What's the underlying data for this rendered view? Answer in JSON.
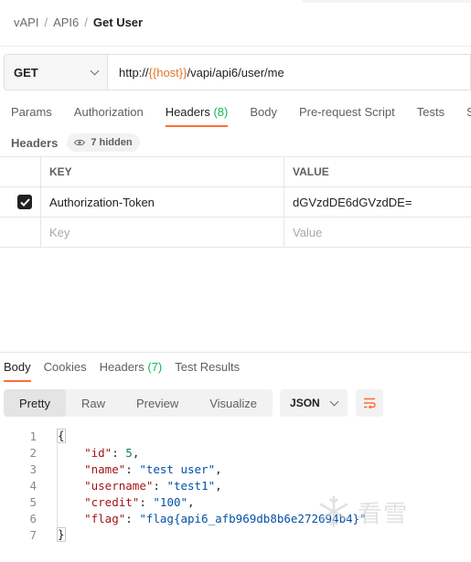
{
  "breadcrumb": {
    "items": [
      "vAPI",
      "API6"
    ],
    "separator": "/",
    "current": "Get User"
  },
  "request": {
    "method": "GET",
    "url_prefix": "http://",
    "url_variable": "{{host}}",
    "url_suffix": "/vapi/api6/user/me"
  },
  "request_tabs": [
    {
      "label": "Params",
      "count": ""
    },
    {
      "label": "Authorization",
      "count": ""
    },
    {
      "label": "Headers",
      "count": "(8)"
    },
    {
      "label": "Body",
      "count": ""
    },
    {
      "label": "Pre-request Script",
      "count": ""
    },
    {
      "label": "Tests",
      "count": ""
    },
    {
      "label": "S",
      "count": ""
    }
  ],
  "headers_section": {
    "title": "Headers",
    "hidden_label": "7 hidden",
    "columns": {
      "key": "KEY",
      "value": "VALUE"
    },
    "rows": [
      {
        "checked": true,
        "key": "Authorization-Token",
        "value": "dGVzdDE6dGVzdDE="
      }
    ],
    "placeholder_row": {
      "key": "Key",
      "value": "Value"
    }
  },
  "response_tabs": [
    {
      "label": "Body",
      "count": ""
    },
    {
      "label": "Cookies",
      "count": ""
    },
    {
      "label": "Headers",
      "count": "(7)"
    },
    {
      "label": "Test Results",
      "count": ""
    }
  ],
  "view_options": [
    "Pretty",
    "Raw",
    "Preview",
    "Visualize"
  ],
  "format": "JSON",
  "response_body": {
    "line_numbers": [
      "1",
      "2",
      "3",
      "4",
      "5",
      "6",
      "7"
    ],
    "open_brace": "{",
    "close_brace": "}",
    "fields": [
      {
        "key": "\"id\"",
        "value": "5",
        "type": "number",
        "comma": ","
      },
      {
        "key": "\"name\"",
        "value": "\"test user\"",
        "type": "string",
        "comma": ","
      },
      {
        "key": "\"username\"",
        "value": "\"test1\"",
        "type": "string",
        "comma": ","
      },
      {
        "key": "\"credit\"",
        "value": "\"100\"",
        "type": "string",
        "comma": ","
      },
      {
        "key": "\"flag\"",
        "value": "\"flag{api6_afb969db8b6e272694b4}\"",
        "type": "string",
        "comma": ""
      }
    ]
  },
  "watermark": {
    "text": "看雪",
    "icon": "snowflake-icon"
  },
  "colors": {
    "accent": "#ff6c37",
    "count_green": "#0cbb52",
    "url_variable": "#e0752d",
    "json_key": "#a31515",
    "json_string": "#0451a5",
    "json_number": "#098658"
  }
}
